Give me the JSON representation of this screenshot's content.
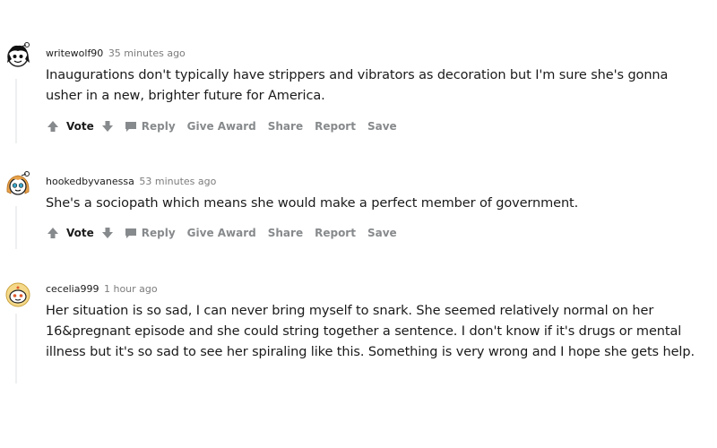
{
  "comments": [
    {
      "username": "writewolf90",
      "timestamp": "35 minutes ago",
      "avatar": "snoo-avatar-black-hair",
      "text": "Inaugurations don't typically have strippers and vibrators as decoration but I'm sure she's gonna usher in a new, brighter future for America.",
      "actions": {
        "vote": "Vote",
        "reply": "Reply",
        "give_award": "Give Award",
        "share": "Share",
        "report": "Report",
        "save": "Save"
      }
    },
    {
      "username": "hookedbyvanessa",
      "timestamp": "53 minutes ago",
      "avatar": "snoo-avatar-orange-hair",
      "text": "She's a sociopath which means she would make a perfect member of government.",
      "actions": {
        "vote": "Vote",
        "reply": "Reply",
        "give_award": "Give Award",
        "share": "Share",
        "report": "Report",
        "save": "Save"
      }
    },
    {
      "username": "cecelia999",
      "timestamp": "1 hour ago",
      "avatar": "snoo-avatar-yellow",
      "text": "Her situation is so sad, I can never bring myself to snark. She seemed relatively normal on her 16&pregnant episode and she could string together a sentence. I don't know if it's drugs or mental illness but it's so sad to see her spiraling like this. Something is very wrong and I hope she gets help."
    }
  ],
  "colors": {
    "text": "#1a1a1b",
    "meta": "#7c7c7c",
    "action": "#878a8c",
    "thread_line": "#edeff1"
  }
}
